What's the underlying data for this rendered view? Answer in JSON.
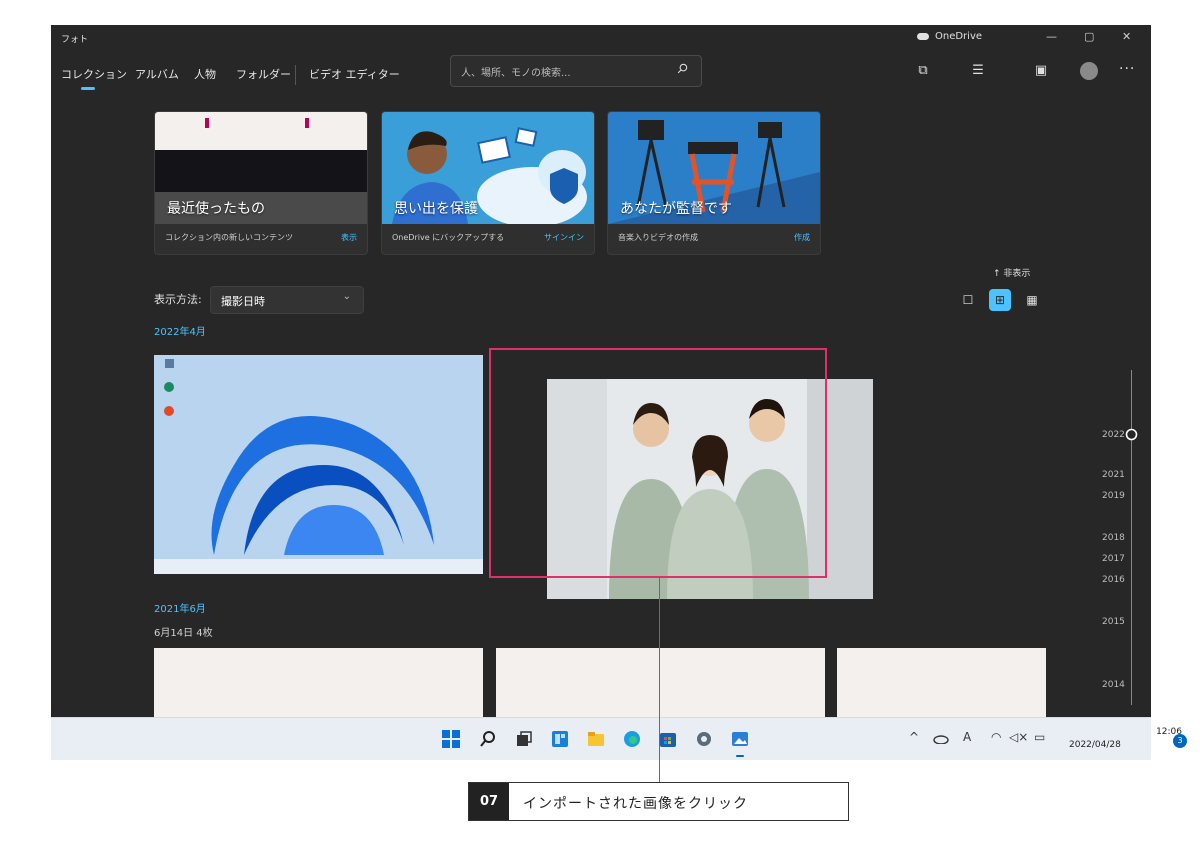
{
  "window": {
    "app_title": "フォト",
    "onedrive_label": "OneDrive",
    "minimize_glyph": "—",
    "maximize_glyph": "▢",
    "close_glyph": "✕"
  },
  "nav": {
    "tabs": [
      {
        "label": "コレクション",
        "active": true
      },
      {
        "label": "アルバム"
      },
      {
        "label": "人物"
      },
      {
        "label": "フォルダー"
      },
      {
        "label": "ビデオ エディター"
      }
    ]
  },
  "search": {
    "placeholder": "人、場所、モノの検索..."
  },
  "toolbar_icons": [
    "import-icon",
    "select-icon",
    "slideshow-icon",
    "account-icon",
    "more-icon"
  ],
  "cards": [
    {
      "title": "最近使ったもの",
      "desc": "コレクション内の新しいコンテンツ",
      "action": "表示"
    },
    {
      "title": "思い出を保護",
      "desc": "OneDrive にバックアップする",
      "action": "サインイン"
    },
    {
      "title": "あなたが監督です",
      "desc": "音楽入りビデオの作成",
      "action": "作成"
    }
  ],
  "view": {
    "label": "表示方法:",
    "selected": "撮影日時",
    "hide_label": "↑ 非表示",
    "modes": [
      "single-icon",
      "medium-grid-icon",
      "small-grid-icon"
    ],
    "active_mode": 1
  },
  "groups": [
    {
      "month": "2022年4月",
      "photos": [
        "windows-desktop-screenshot",
        "three-workers-photo"
      ]
    },
    {
      "month": "2021年6月",
      "day": "6月14日  4枚",
      "photos": [
        "screenshot-thumb",
        "screenshot-thumb",
        "screenshot-thumb"
      ]
    }
  ],
  "timeline": {
    "years": [
      "2022",
      "2021",
      "2019",
      "2018",
      "2017",
      "2016",
      "2015",
      "2014"
    ],
    "current": "2022"
  },
  "taskbar": {
    "apps": [
      "start-icon",
      "search-icon",
      "task-view-icon",
      "widgets-icon",
      "file-explorer-icon",
      "edge-icon",
      "store-icon",
      "settings-icon",
      "photos-icon"
    ],
    "tray": {
      "chevron": "^",
      "ime": "A",
      "time": "12:06",
      "date": "2022/04/28",
      "notifications": "3"
    }
  },
  "callout": {
    "number": "07",
    "text": "インポートされた画像をクリック"
  },
  "colors": {
    "accent": "#4cc2ff",
    "highlight": "#e0306a",
    "window_bg": "#272727"
  }
}
